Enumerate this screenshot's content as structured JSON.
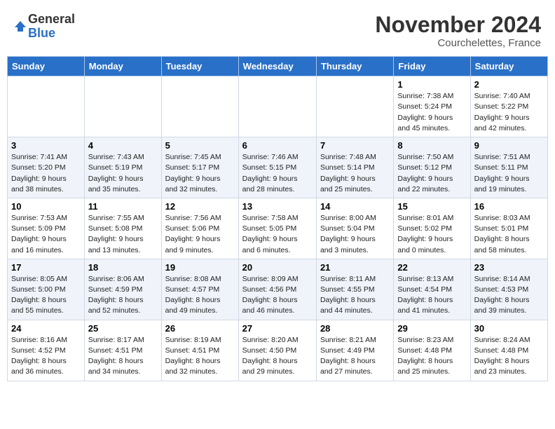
{
  "header": {
    "logo_line1": "General",
    "logo_line2": "Blue",
    "month": "November 2024",
    "location": "Courchelettes, France"
  },
  "weekdays": [
    "Sunday",
    "Monday",
    "Tuesday",
    "Wednesday",
    "Thursday",
    "Friday",
    "Saturday"
  ],
  "weeks": [
    [
      {
        "day": "",
        "detail": ""
      },
      {
        "day": "",
        "detail": ""
      },
      {
        "day": "",
        "detail": ""
      },
      {
        "day": "",
        "detail": ""
      },
      {
        "day": "",
        "detail": ""
      },
      {
        "day": "1",
        "detail": "Sunrise: 7:38 AM\nSunset: 5:24 PM\nDaylight: 9 hours\nand 45 minutes."
      },
      {
        "day": "2",
        "detail": "Sunrise: 7:40 AM\nSunset: 5:22 PM\nDaylight: 9 hours\nand 42 minutes."
      }
    ],
    [
      {
        "day": "3",
        "detail": "Sunrise: 7:41 AM\nSunset: 5:20 PM\nDaylight: 9 hours\nand 38 minutes."
      },
      {
        "day": "4",
        "detail": "Sunrise: 7:43 AM\nSunset: 5:19 PM\nDaylight: 9 hours\nand 35 minutes."
      },
      {
        "day": "5",
        "detail": "Sunrise: 7:45 AM\nSunset: 5:17 PM\nDaylight: 9 hours\nand 32 minutes."
      },
      {
        "day": "6",
        "detail": "Sunrise: 7:46 AM\nSunset: 5:15 PM\nDaylight: 9 hours\nand 28 minutes."
      },
      {
        "day": "7",
        "detail": "Sunrise: 7:48 AM\nSunset: 5:14 PM\nDaylight: 9 hours\nand 25 minutes."
      },
      {
        "day": "8",
        "detail": "Sunrise: 7:50 AM\nSunset: 5:12 PM\nDaylight: 9 hours\nand 22 minutes."
      },
      {
        "day": "9",
        "detail": "Sunrise: 7:51 AM\nSunset: 5:11 PM\nDaylight: 9 hours\nand 19 minutes."
      }
    ],
    [
      {
        "day": "10",
        "detail": "Sunrise: 7:53 AM\nSunset: 5:09 PM\nDaylight: 9 hours\nand 16 minutes."
      },
      {
        "day": "11",
        "detail": "Sunrise: 7:55 AM\nSunset: 5:08 PM\nDaylight: 9 hours\nand 13 minutes."
      },
      {
        "day": "12",
        "detail": "Sunrise: 7:56 AM\nSunset: 5:06 PM\nDaylight: 9 hours\nand 9 minutes."
      },
      {
        "day": "13",
        "detail": "Sunrise: 7:58 AM\nSunset: 5:05 PM\nDaylight: 9 hours\nand 6 minutes."
      },
      {
        "day": "14",
        "detail": "Sunrise: 8:00 AM\nSunset: 5:04 PM\nDaylight: 9 hours\nand 3 minutes."
      },
      {
        "day": "15",
        "detail": "Sunrise: 8:01 AM\nSunset: 5:02 PM\nDaylight: 9 hours\nand 0 minutes."
      },
      {
        "day": "16",
        "detail": "Sunrise: 8:03 AM\nSunset: 5:01 PM\nDaylight: 8 hours\nand 58 minutes."
      }
    ],
    [
      {
        "day": "17",
        "detail": "Sunrise: 8:05 AM\nSunset: 5:00 PM\nDaylight: 8 hours\nand 55 minutes."
      },
      {
        "day": "18",
        "detail": "Sunrise: 8:06 AM\nSunset: 4:59 PM\nDaylight: 8 hours\nand 52 minutes."
      },
      {
        "day": "19",
        "detail": "Sunrise: 8:08 AM\nSunset: 4:57 PM\nDaylight: 8 hours\nand 49 minutes."
      },
      {
        "day": "20",
        "detail": "Sunrise: 8:09 AM\nSunset: 4:56 PM\nDaylight: 8 hours\nand 46 minutes."
      },
      {
        "day": "21",
        "detail": "Sunrise: 8:11 AM\nSunset: 4:55 PM\nDaylight: 8 hours\nand 44 minutes."
      },
      {
        "day": "22",
        "detail": "Sunrise: 8:13 AM\nSunset: 4:54 PM\nDaylight: 8 hours\nand 41 minutes."
      },
      {
        "day": "23",
        "detail": "Sunrise: 8:14 AM\nSunset: 4:53 PM\nDaylight: 8 hours\nand 39 minutes."
      }
    ],
    [
      {
        "day": "24",
        "detail": "Sunrise: 8:16 AM\nSunset: 4:52 PM\nDaylight: 8 hours\nand 36 minutes."
      },
      {
        "day": "25",
        "detail": "Sunrise: 8:17 AM\nSunset: 4:51 PM\nDaylight: 8 hours\nand 34 minutes."
      },
      {
        "day": "26",
        "detail": "Sunrise: 8:19 AM\nSunset: 4:51 PM\nDaylight: 8 hours\nand 32 minutes."
      },
      {
        "day": "27",
        "detail": "Sunrise: 8:20 AM\nSunset: 4:50 PM\nDaylight: 8 hours\nand 29 minutes."
      },
      {
        "day": "28",
        "detail": "Sunrise: 8:21 AM\nSunset: 4:49 PM\nDaylight: 8 hours\nand 27 minutes."
      },
      {
        "day": "29",
        "detail": "Sunrise: 8:23 AM\nSunset: 4:48 PM\nDaylight: 8 hours\nand 25 minutes."
      },
      {
        "day": "30",
        "detail": "Sunrise: 8:24 AM\nSunset: 4:48 PM\nDaylight: 8 hours\nand 23 minutes."
      }
    ]
  ]
}
